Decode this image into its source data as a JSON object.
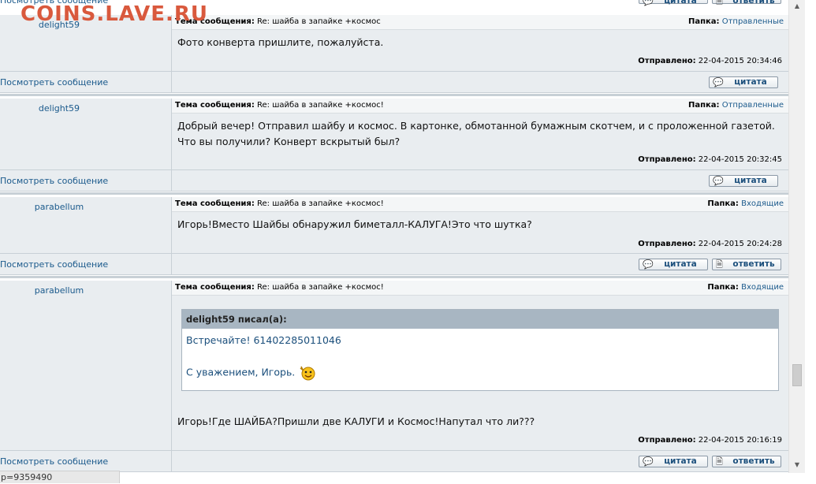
{
  "watermark": "COINS.LAVE.RU",
  "labels": {
    "subject": "Тема сообщения:",
    "folder": "Папка:",
    "sent": "Отправлено:",
    "view_message": "Посмотреть сообщение",
    "quote": "цитата",
    "reply": "ответить"
  },
  "messages": [
    {
      "author": "delight59",
      "subject": "Re: шайба в запайке +космос",
      "folder": "Отправленные",
      "body": [
        "Фото конверта пришлите, пожалуйста."
      ],
      "sent": "22-04-2015 20:34:46"
    },
    {
      "author": "delight59",
      "subject": "Re: шайба в запайке +космос!",
      "folder": "Отправленные",
      "body": [
        "Добрый вечер! Отправил шайбу и космос. В картонке, обмотанной бумажным скотчем, и с проложенной газетой.",
        "Что вы получили? Конверт вскрытый был?"
      ],
      "sent": "22-04-2015 20:32:45"
    },
    {
      "author": "parabellum",
      "subject": "Re: шайба в запайке +космос!",
      "folder": "Входящие",
      "body": [
        "Игорь!Вместо Шайбы обнаружил биметалл-КАЛУГА!Это что шутка?"
      ],
      "sent": "22-04-2015 20:24:28"
    },
    {
      "author": "parabellum",
      "subject": "Re: шайба в запайке +космос!",
      "folder": "Входящие",
      "quote_header": "delight59 писал(а):",
      "quote_line1": "Встречайте! 61402285011046",
      "quote_line2": "С уважением, Игорь.",
      "body": [
        "Игорь!Где ШАЙБА?Пришли две КАЛУГИ и Космос!Напутал что ли???"
      ],
      "sent": "22-04-2015 20:16:19"
    }
  ],
  "status_bar": "p=9359490"
}
